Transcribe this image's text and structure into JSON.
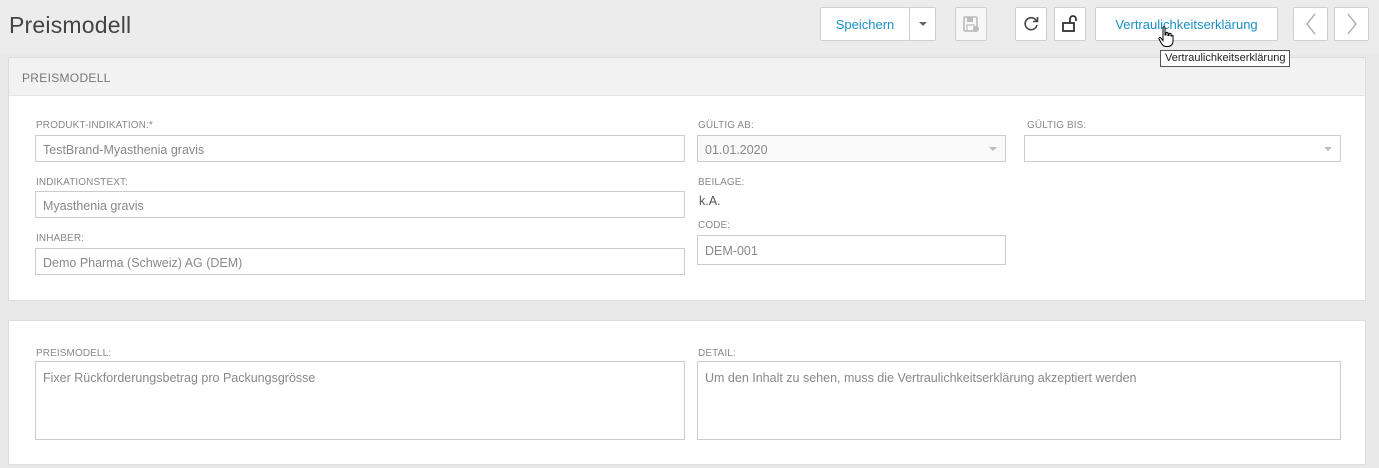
{
  "page": {
    "title": "Preismodell"
  },
  "toolbar": {
    "save_label": "Speichern",
    "confidentiality_label": "Vertraulichkeitserklärung",
    "tooltip": "Vertraulichkeitserklärung",
    "icons": {
      "save_dropdown": "chevron-down-icon",
      "save_disabled": "save-disk-icon",
      "refresh": "refresh-icon",
      "unlock": "unlock-icon",
      "prev": "chevron-left-icon",
      "next": "chevron-right-icon"
    }
  },
  "section1": {
    "header": "PREISMODELL",
    "produkt_indikation": {
      "label": "PRODUKT-INDIKATION:*",
      "value": "TestBrand-Myasthenia gravis"
    },
    "indikationstext": {
      "label": "INDIKATIONSTEXT:",
      "value": "Myasthenia gravis"
    },
    "inhaber": {
      "label": "INHABER:",
      "value": "Demo Pharma (Schweiz) AG (DEM)"
    },
    "gueltig_ab": {
      "label": "GÜLTIG AB:",
      "value": "01.01.2020"
    },
    "gueltig_bis": {
      "label": "GÜLTIG BIS:",
      "value": ""
    },
    "beilage": {
      "label": "BEILAGE:",
      "value": "k.A."
    },
    "code": {
      "label": "CODE:",
      "value": "DEM-001"
    }
  },
  "section2": {
    "preismodell": {
      "label": "PREISMODELL:",
      "value": "Fixer Rückforderungsbetrag pro Packungsgrösse"
    },
    "detail": {
      "label": "DETAIL:",
      "value": "Um den Inhalt zu sehen, muss die Vertraulichkeitserklärung akzeptiert werden"
    }
  },
  "colors": {
    "accent": "#1a8fc4",
    "background": "#e9e9e9",
    "panel_header": "#f2f2f2"
  }
}
